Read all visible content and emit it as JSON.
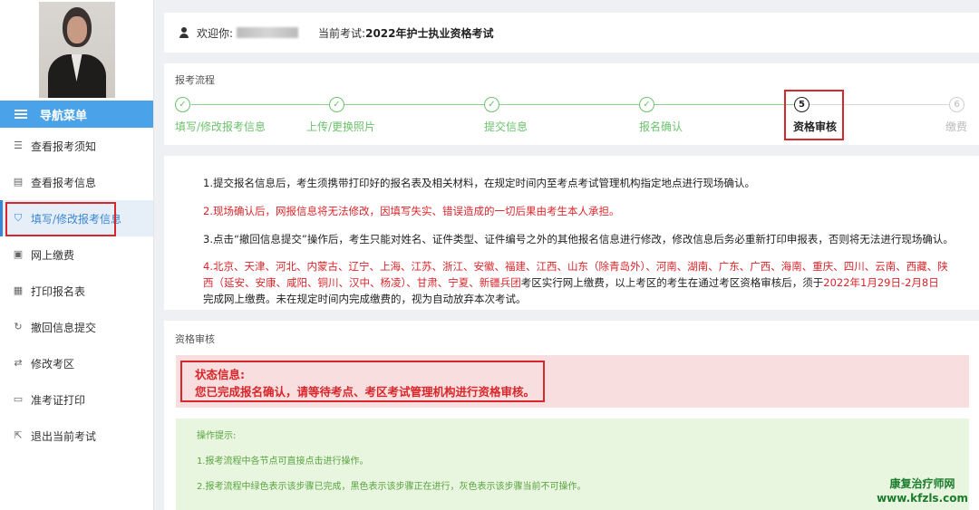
{
  "sidebar": {
    "nav_header": "导航菜单",
    "items": [
      {
        "label": "查看报考须知",
        "icon": "notice-icon"
      },
      {
        "label": "查看报考信息",
        "icon": "document-icon"
      },
      {
        "label": "填写/修改报考信息",
        "icon": "shield-icon",
        "active": true
      },
      {
        "label": "网上缴费",
        "icon": "payment-icon"
      },
      {
        "label": "打印报名表",
        "icon": "print-form-icon"
      },
      {
        "label": "撤回信息提交",
        "icon": "revoke-icon"
      },
      {
        "label": "修改考区",
        "icon": "swap-icon"
      },
      {
        "label": "准考证打印",
        "icon": "id-card-icon"
      },
      {
        "label": "退出当前考试",
        "icon": "exit-icon"
      }
    ]
  },
  "header": {
    "welcome_label": "欢迎你:",
    "current_exam_label": "当前考试:",
    "current_exam": "2022年护士执业资格考试"
  },
  "process": {
    "title": "报考流程",
    "steps": [
      {
        "label": "填写/修改报考信息",
        "state": "done"
      },
      {
        "label": "上传/更换照片",
        "state": "done"
      },
      {
        "label": "提交信息",
        "state": "done"
      },
      {
        "label": "报名确认",
        "state": "done"
      },
      {
        "label": "资格审核",
        "number": "5",
        "state": "current"
      },
      {
        "label": "缴费",
        "number": "6",
        "state": "pending"
      }
    ]
  },
  "notice": {
    "item1": "1.提交报名信息后，考生须携带打印好的报名表及相关材料，在规定时间内至考点考试管理机构指定地点进行现场确认。",
    "item2": "2.现场确认后，网报信息将无法修改，因填写失实、错误造成的一切后果由考生本人承担。",
    "item3": "3.点击“撤回信息提交”操作后，考生只能对姓名、证件类型、证件编号之外的其他报名信息进行修改，修改信息后务必重新打印申报表，否则将无法进行现场确认。",
    "item4_regions": "4.北京、天津、河北、内蒙古、辽宁、上海、江苏、浙江、安徽、福建、江西、山东（除青岛外）、河南、湖南、广东、广西、海南、重庆、四川、云南、西藏、陕西（延安、安康、咸阳、铜川、汉中、杨凌）、甘肃、宁夏、新疆兵团",
    "item4_mid": "考区实行网上缴费，以上考区的考生在通过考区资格审核后，须于",
    "item4_date": "2022年1月29日-2月8日",
    "item4_end": "完成网上缴费。未在规定时间内完成缴费的，视为自动放弃本次考试。"
  },
  "qualification": {
    "title": "资格审核",
    "status_label": "状态信息:",
    "status_text": "您已完成报名确认，请等待考点、考区考试管理机构进行资格审核。",
    "tips_title": "操作提示:",
    "tip1": "1.报考流程中各节点可直接点击进行操作。",
    "tip2": "2.报考流程中绿色表示该步骤已完成，黑色表示该步骤正在进行，灰色表示该步骤当前不可操作。"
  },
  "watermark": {
    "line1": "康复治疗师网",
    "line2": "www.kfzls.com"
  },
  "colors": {
    "accent": "#4aa3e8",
    "done": "#6cc26c",
    "alert": "#d9262b"
  }
}
